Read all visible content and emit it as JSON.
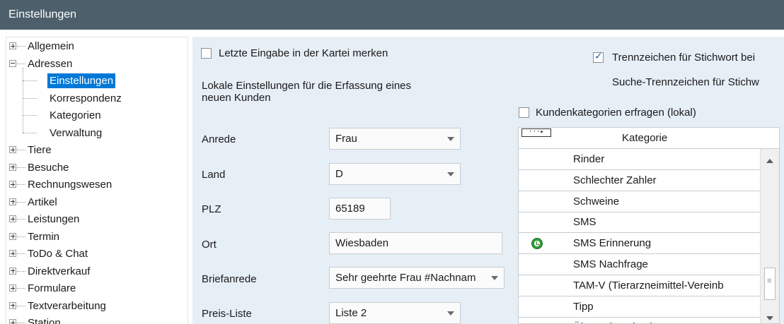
{
  "window": {
    "title": "Einstellungen"
  },
  "tree": {
    "items": [
      {
        "label": "Allgemein",
        "level": 0,
        "expander": "plus"
      },
      {
        "label": "Adressen",
        "level": 0,
        "expander": "minus"
      },
      {
        "label": "Einstellungen",
        "level": 1,
        "selected": true
      },
      {
        "label": "Korrespondenz",
        "level": 1
      },
      {
        "label": "Kategorien",
        "level": 1
      },
      {
        "label": "Verwaltung",
        "level": 1
      },
      {
        "label": "Tiere",
        "level": 0,
        "expander": "plus"
      },
      {
        "label": "Besuche",
        "level": 0,
        "expander": "plus"
      },
      {
        "label": "Rechnungswesen",
        "level": 0,
        "expander": "plus"
      },
      {
        "label": "Artikel",
        "level": 0,
        "expander": "plus"
      },
      {
        "label": "Leistungen",
        "level": 0,
        "expander": "plus"
      },
      {
        "label": "Termin",
        "level": 0,
        "expander": "plus"
      },
      {
        "label": "ToDo & Chat",
        "level": 0,
        "expander": "plus"
      },
      {
        "label": "Direktverkauf",
        "level": 0,
        "expander": "plus"
      },
      {
        "label": "Formulare",
        "level": 0,
        "expander": "plus"
      },
      {
        "label": "Textverarbeitung",
        "level": 0,
        "expander": "plus"
      },
      {
        "label": "Station",
        "level": 0,
        "expander": "plus"
      }
    ]
  },
  "settings": {
    "remember_last_input": {
      "label": "Letzte Eingabe in der Kartei merken",
      "checked": false
    },
    "separator_keyword": {
      "label": "Trennzeichen für Stichwort bei",
      "checked": true
    },
    "search_separator_label": "Suche-Trennzeichen für Stichw",
    "local_settings_heading_line1": "Lokale Einstellungen für die Erfassung eines",
    "local_settings_heading_line2": "neuen Kunden",
    "ask_categories": {
      "label": "Kundenkategorien erfragen (lokal)",
      "checked": false
    },
    "fields": {
      "anrede": {
        "label": "Anrede",
        "value": "Frau"
      },
      "land": {
        "label": "Land",
        "value": "D"
      },
      "plz": {
        "label": "PLZ",
        "value": "65189"
      },
      "ort": {
        "label": "Ort",
        "value": "Wiesbaden"
      },
      "briefanrede": {
        "label": "Briefanrede",
        "value": "Sehr geehrte Frau #Nachnam"
      },
      "preisliste": {
        "label": "Preis-Liste",
        "value": "Liste 2"
      }
    }
  },
  "category_grid": {
    "header_button": "···▸",
    "column_header": "Kategorie",
    "rows": [
      {
        "label": "Rinder",
        "icon": ""
      },
      {
        "label": "Schlechter Zahler",
        "icon": ""
      },
      {
        "label": "Schweine",
        "icon": ""
      },
      {
        "label": "SMS",
        "icon": ""
      },
      {
        "label": "SMS Erinnerung",
        "icon": "clock-icon"
      },
      {
        "label": "SMS Nachfrage",
        "icon": ""
      },
      {
        "label": "TAM-V (Tierarzneimittel-Vereinb",
        "icon": ""
      },
      {
        "label": "Tipp",
        "icon": ""
      },
      {
        "label": "Überweisende Tierarzt",
        "icon": ""
      }
    ]
  },
  "colors": {
    "titlebar": "#4c5f6b",
    "panel_background": "#e6eef6",
    "selection": "#0078d7",
    "sms_icon": "#2f9e3a"
  }
}
